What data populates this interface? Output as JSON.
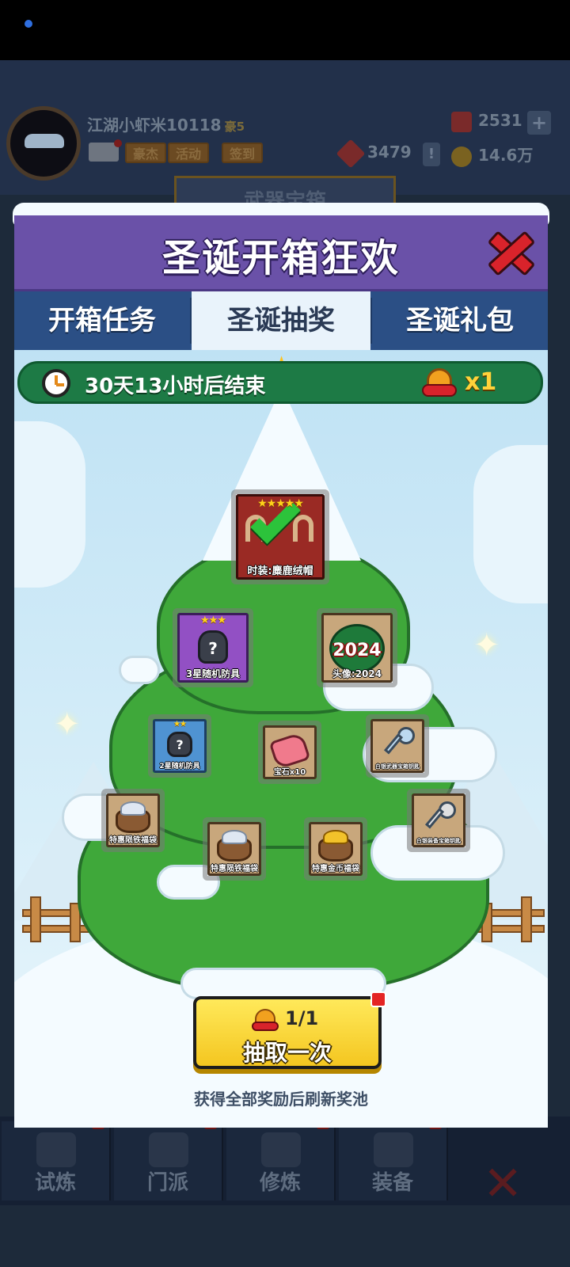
{
  "background": {
    "player_name": "江湖小虾米10118",
    "vip_level": "豪5",
    "tags": [
      "豪杰",
      "活动",
      "签到"
    ],
    "gems": "2531",
    "tokens": "3479",
    "coins": "14.6万",
    "plus_label": "+",
    "alert_label": "!",
    "banner": "武器宝箱",
    "nav": [
      "试炼",
      "门派",
      "修炼",
      "装备"
    ],
    "close_glyph": "✕"
  },
  "modal": {
    "title": "圣诞开箱狂欢",
    "tabs": [
      {
        "label": "开箱任务",
        "active": false
      },
      {
        "label": "圣诞抽奖",
        "active": true
      },
      {
        "label": "圣诞礼包",
        "active": false
      }
    ],
    "timer_text": "30天13小时后结束",
    "bell_count": "x1",
    "star_glyph": "★",
    "rewards": [
      {
        "label": "时装:麋鹿绒帽",
        "stars": "★★★★★",
        "claimed": true
      },
      {
        "label": "3星随机防具",
        "stars": "★★★",
        "icon_text": "?"
      },
      {
        "label": "头像:2024",
        "icon_text": "2024"
      },
      {
        "label": "2星随机防具",
        "stars": "★★",
        "icon_text": "?"
      },
      {
        "label": "宝石x10"
      },
      {
        "label": "白银武器宝箱钥匙"
      },
      {
        "label": "特惠陨铁福袋"
      },
      {
        "label": "特惠陨铁福袋"
      },
      {
        "label": "特惠金币福袋"
      },
      {
        "label": "白银装备宝箱钥匙"
      }
    ],
    "draw_button": {
      "count": "1/1",
      "label": "抽取一次"
    },
    "refresh_note": "获得全部奖励后刷新奖池",
    "sparkle_glyph": "✦",
    "colors": {
      "header": "#6a51a8",
      "tab_bar": "#2b4f85",
      "timer_bar": "#1d7a45",
      "draw_button": "#f4c620",
      "tree": "#3fa83a"
    }
  }
}
